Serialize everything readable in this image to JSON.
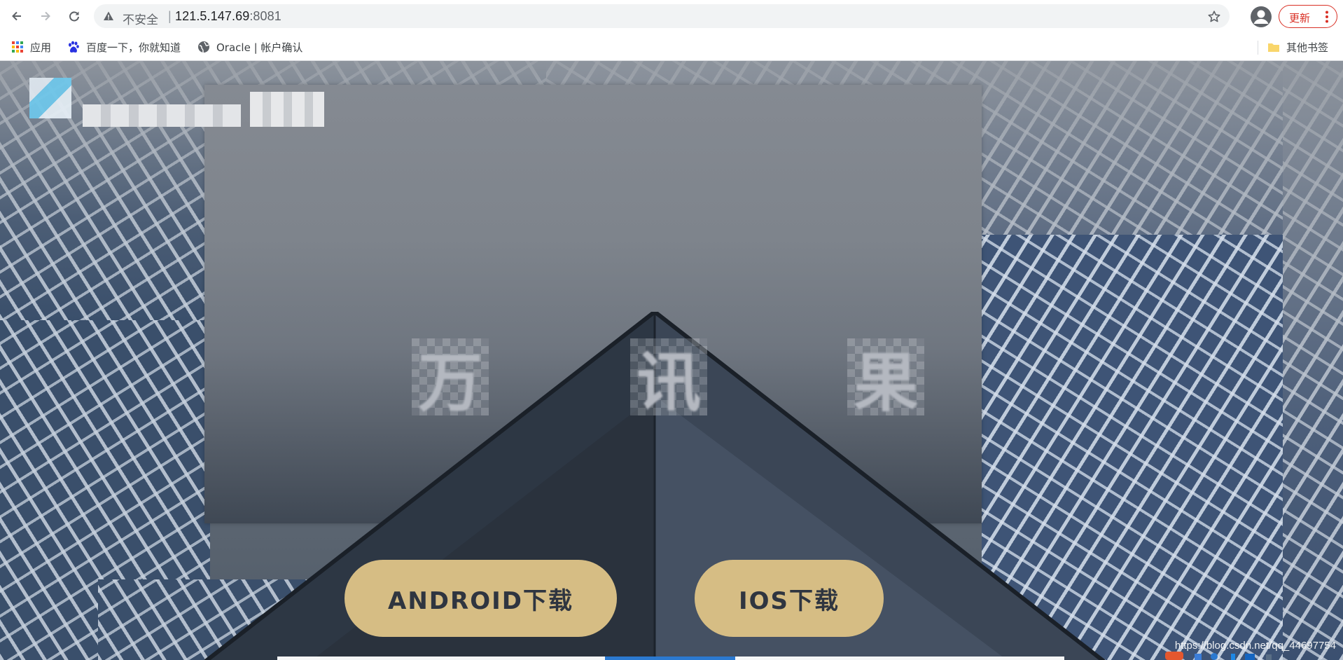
{
  "browser": {
    "security_label": "不安全",
    "url_host": "121.5.147.69",
    "url_port": ":8081",
    "update_label": "更新"
  },
  "bookmarks": {
    "apps": "应用",
    "items": [
      {
        "label": "百度一下，你就知道",
        "icon": "baidu-paw-icon"
      },
      {
        "label": "Oracle | 帐户确认",
        "icon": "globe-icon"
      }
    ],
    "other": "其他书签"
  },
  "page": {
    "brand_chars": [
      "万",
      "讯",
      "果"
    ],
    "android_button": "ANDROID下载",
    "ios_button": "IOS下载",
    "watermark": "https://blog.csdn.net/qq_44697754"
  },
  "colors": {
    "button_gold": "#d6bd84",
    "button_text": "#2f3540",
    "update_red": "#d93025"
  }
}
